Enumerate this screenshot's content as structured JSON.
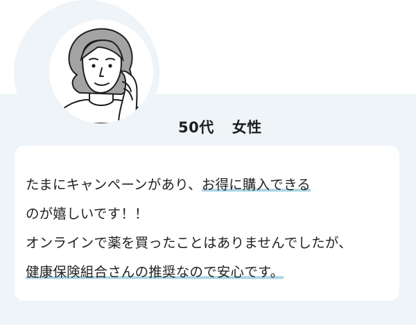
{
  "persona": {
    "age": "50代",
    "gender": "女性"
  },
  "review": {
    "line1_plain": "たまにキャンペーンがあり、",
    "line1_highlight": "お得に購入できる",
    "line2": "のが嬉しいです！！",
    "line3": "オンラインで薬を買ったことはありませんでしたが、",
    "line4_highlight": "健康保険組合さんの推奨なので安心です。"
  },
  "colors": {
    "band": "#eef4f8",
    "highlight": "#a9d3e2",
    "card": "#ffffff",
    "hair": "#a3a3a3"
  },
  "icons": {
    "avatar": "middle-aged-woman-portrait-icon"
  }
}
